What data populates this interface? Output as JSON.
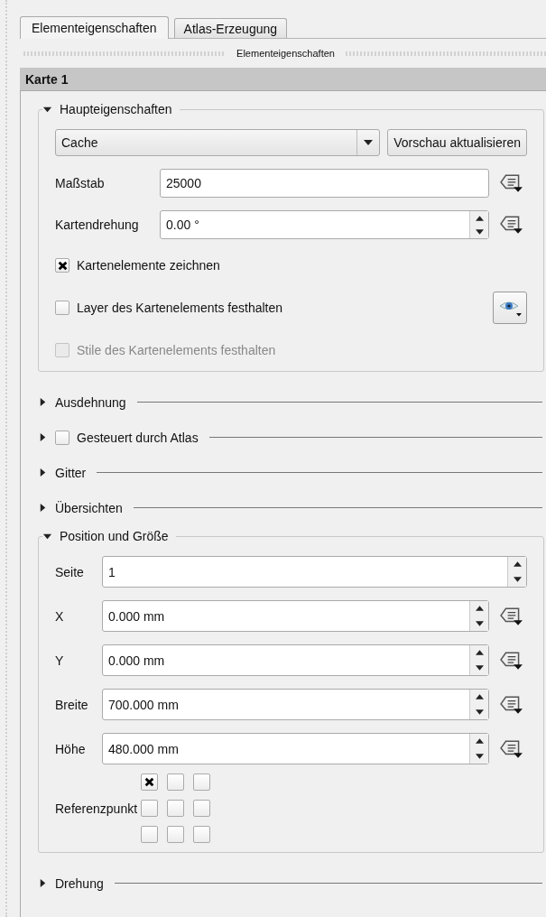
{
  "tabs": [
    {
      "label": "Elementeigenschaften",
      "selected": true
    },
    {
      "label": "Atlas-Erzeugung",
      "selected": false
    }
  ],
  "panel_title": "Elementeigenschaften",
  "item_title": "Karte 1",
  "sections": [
    {
      "kind": "main",
      "title": "Haupteigenschaften",
      "expanded": true,
      "mode_combo": {
        "value": "Cache"
      },
      "preview_button": "Vorschau aktualisieren",
      "fields": [
        {
          "label": "Maßstab",
          "value": "25000",
          "spin": false,
          "data_defined": true
        },
        {
          "label": "Kartendrehung",
          "value": "0.00 °",
          "spin": true,
          "data_defined": true
        }
      ],
      "checkboxes": [
        {
          "label": "Kartenelemente zeichnen",
          "checked": true,
          "disabled": false,
          "eye_button": false
        },
        {
          "label": "Layer des Kartenelements festhalten",
          "checked": false,
          "disabled": false,
          "eye_button": true
        },
        {
          "label": "Stile des Kartenelements festhalten",
          "checked": false,
          "disabled": true,
          "eye_button": false
        }
      ]
    },
    {
      "kind": "plain",
      "title": "Ausdehnung",
      "expanded": false
    },
    {
      "kind": "checkable",
      "title": "Gesteuert durch Atlas",
      "expanded": false,
      "checked": false
    },
    {
      "kind": "plain",
      "title": "Gitter",
      "expanded": false
    },
    {
      "kind": "plain",
      "title": "Übersichten",
      "expanded": false
    },
    {
      "kind": "position",
      "title": "Position und Größe",
      "expanded": true,
      "fields": [
        {
          "label": "Seite",
          "value": "1",
          "spin": true,
          "data_defined": false
        },
        {
          "label": "X",
          "value": "0.000 mm",
          "spin": true,
          "data_defined": true
        },
        {
          "label": "Y",
          "value": "0.000 mm",
          "spin": true,
          "data_defined": true
        },
        {
          "label": "Breite",
          "value": "700.000 mm",
          "spin": true,
          "data_defined": true
        },
        {
          "label": "Höhe",
          "value": "480.000 mm",
          "spin": true,
          "data_defined": true
        }
      ],
      "reference_point": {
        "label": "Referenzpunkt",
        "cells": [
          {
            "checked": true
          },
          {
            "checked": false
          },
          {
            "checked": false
          },
          {
            "checked": false
          },
          {
            "checked": false
          },
          {
            "checked": false
          },
          {
            "checked": false
          },
          {
            "checked": false
          },
          {
            "checked": false
          }
        ]
      }
    },
    {
      "kind": "plain",
      "title": "Drehung",
      "expanded": false
    }
  ]
}
